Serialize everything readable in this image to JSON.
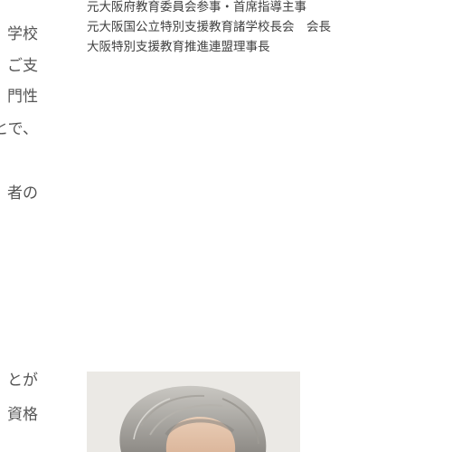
{
  "left_column_fragments": [
    "学校",
    "ご支",
    "門性",
    "とで、",
    "者の",
    "とが",
    "資格"
  ],
  "profile": {
    "career_lines": [
      "元大阪府教育委員会参事・首席指導主事",
      "元大阪国公立特別支援教育諸学校長会　会長",
      "大阪特別支援教育推進連盟理事長"
    ]
  },
  "photo": {
    "alt": "portrait-photo"
  }
}
